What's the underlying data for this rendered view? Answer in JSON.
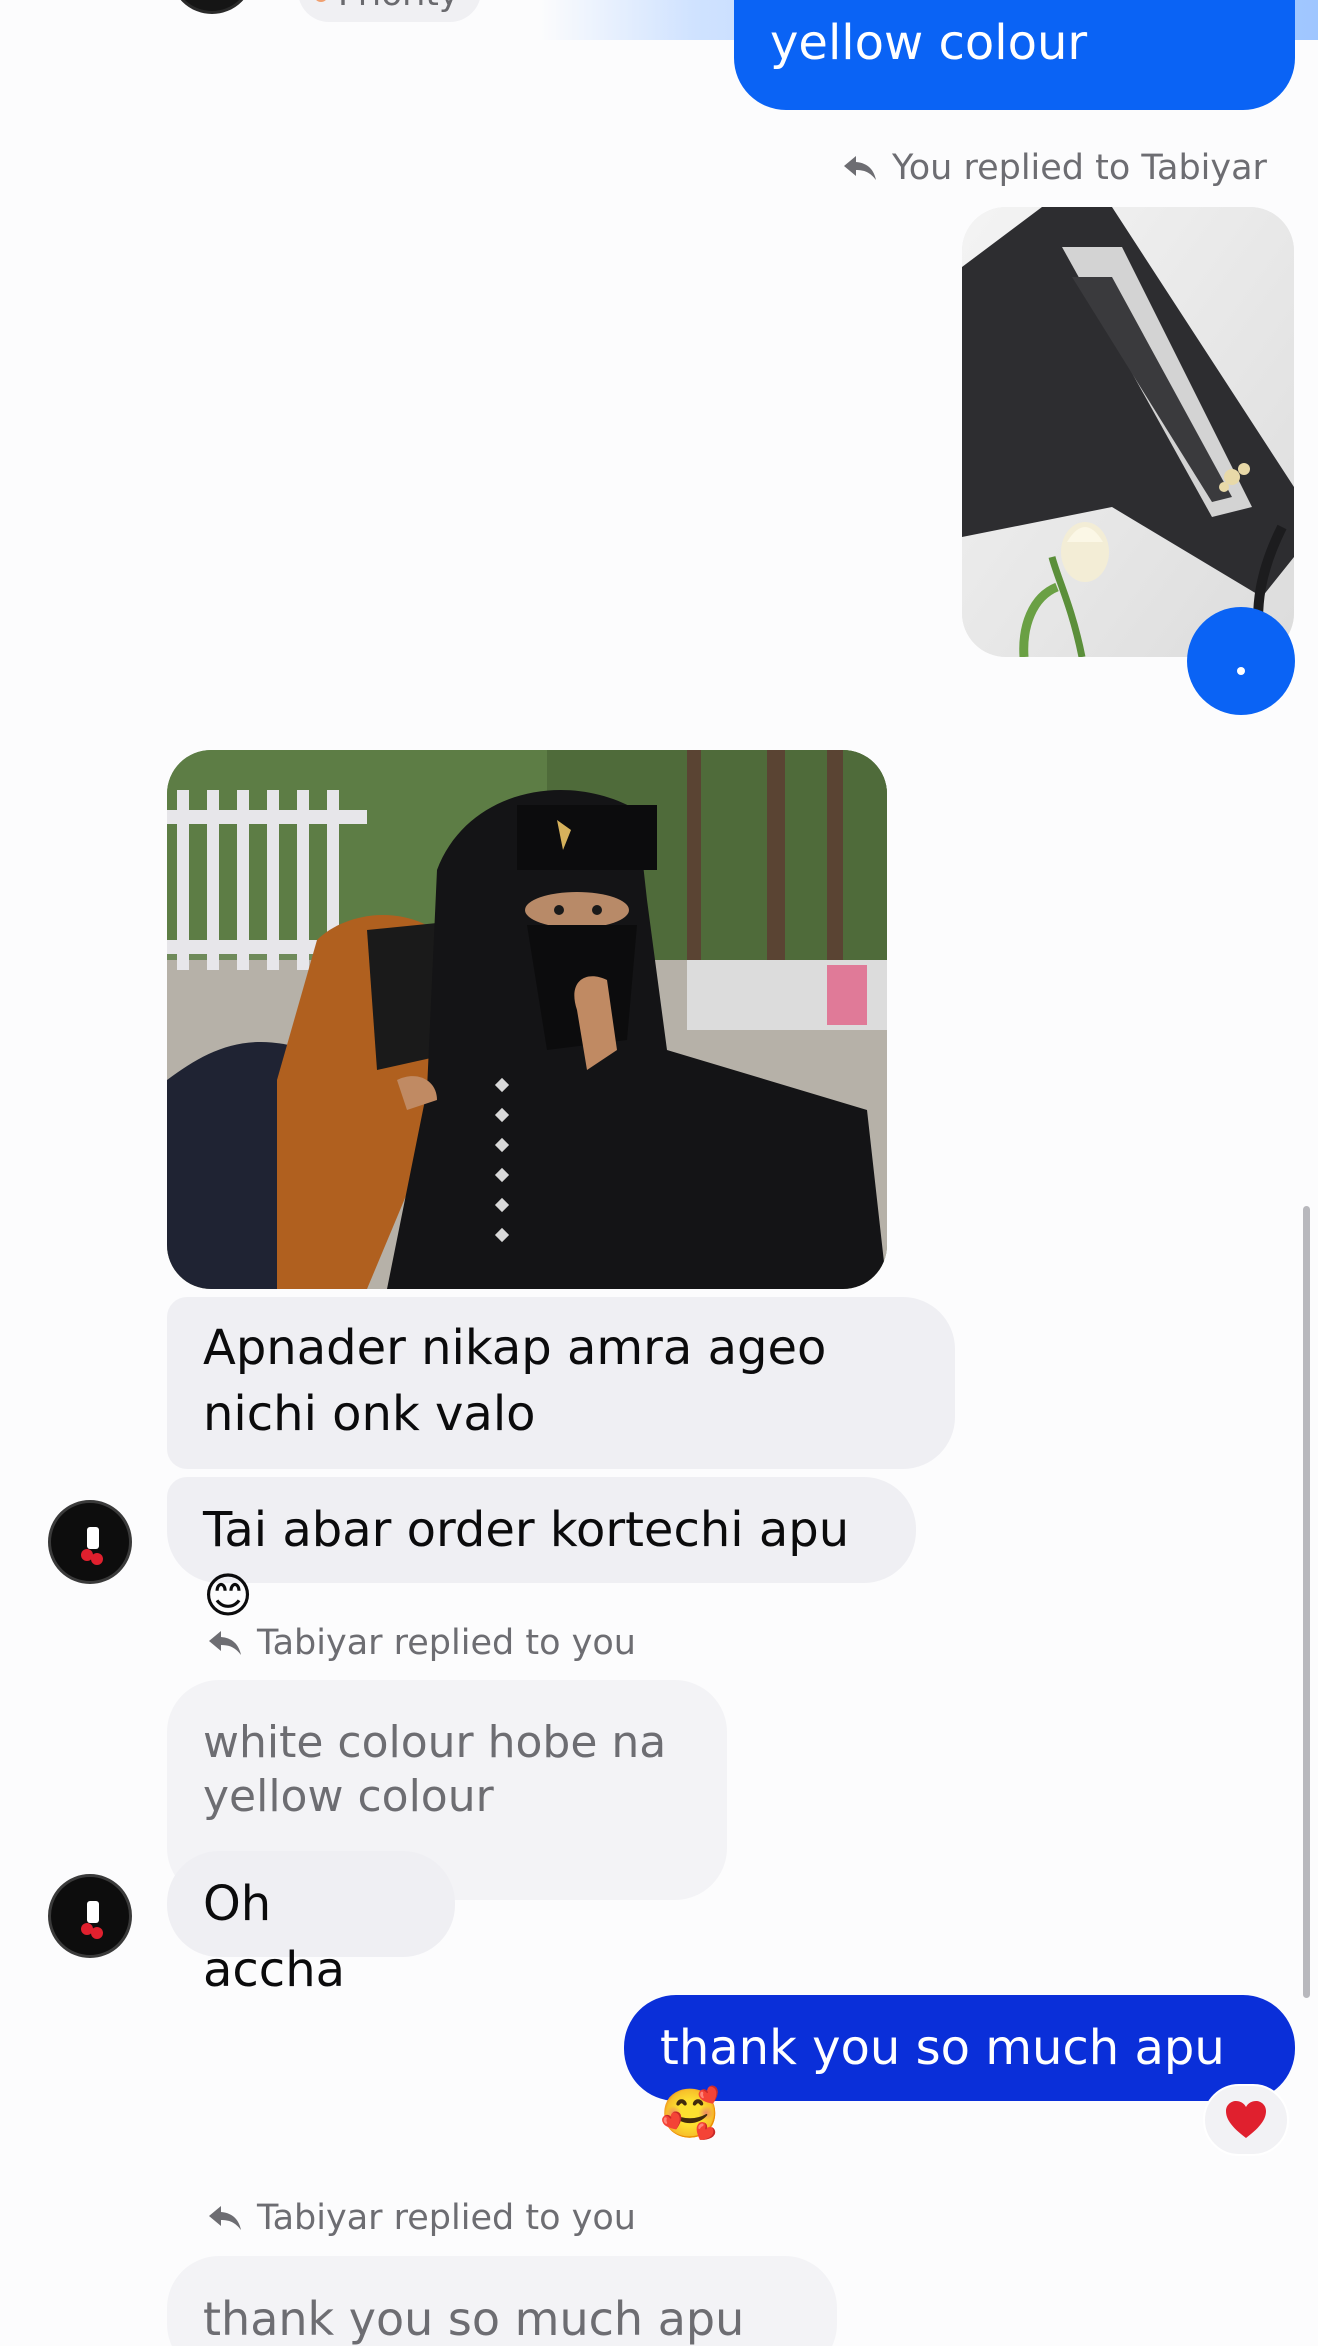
{
  "header_fragment": {
    "chip_label": "Priority"
  },
  "messages": {
    "top_out": {
      "text": "yellow colour"
    },
    "reply_to_tabiyar": {
      "label": "You replied to Tabiyar"
    },
    "incoming_1": {
      "text": "Apnader nikap amra ageo nichi onk valo"
    },
    "incoming_2": {
      "text": "Tai abar order kortechi apu😊"
    },
    "reply_from_tabiyar_1": {
      "label": "Tabiyar replied to you",
      "quoted_text": "white colour hobe na yellow colour"
    },
    "incoming_3": {
      "text": "Oh accha"
    },
    "out_thanks": {
      "text": "thank you so much apu🥰",
      "reaction": "❤️"
    },
    "reply_from_tabiyar_2": {
      "label": "Tabiyar replied to you",
      "quoted_text": "thank you so much apu🥰"
    }
  },
  "colors": {
    "outgoing_blue": "#0a63f5",
    "outgoing_deep_blue": "#0a2fd9",
    "incoming_gray": "#efeff3",
    "reaction_red": "#e0202e"
  },
  "icons": {
    "reply": "reply-arrow-icon",
    "send": "send-icon",
    "reaction": "heart-icon"
  }
}
